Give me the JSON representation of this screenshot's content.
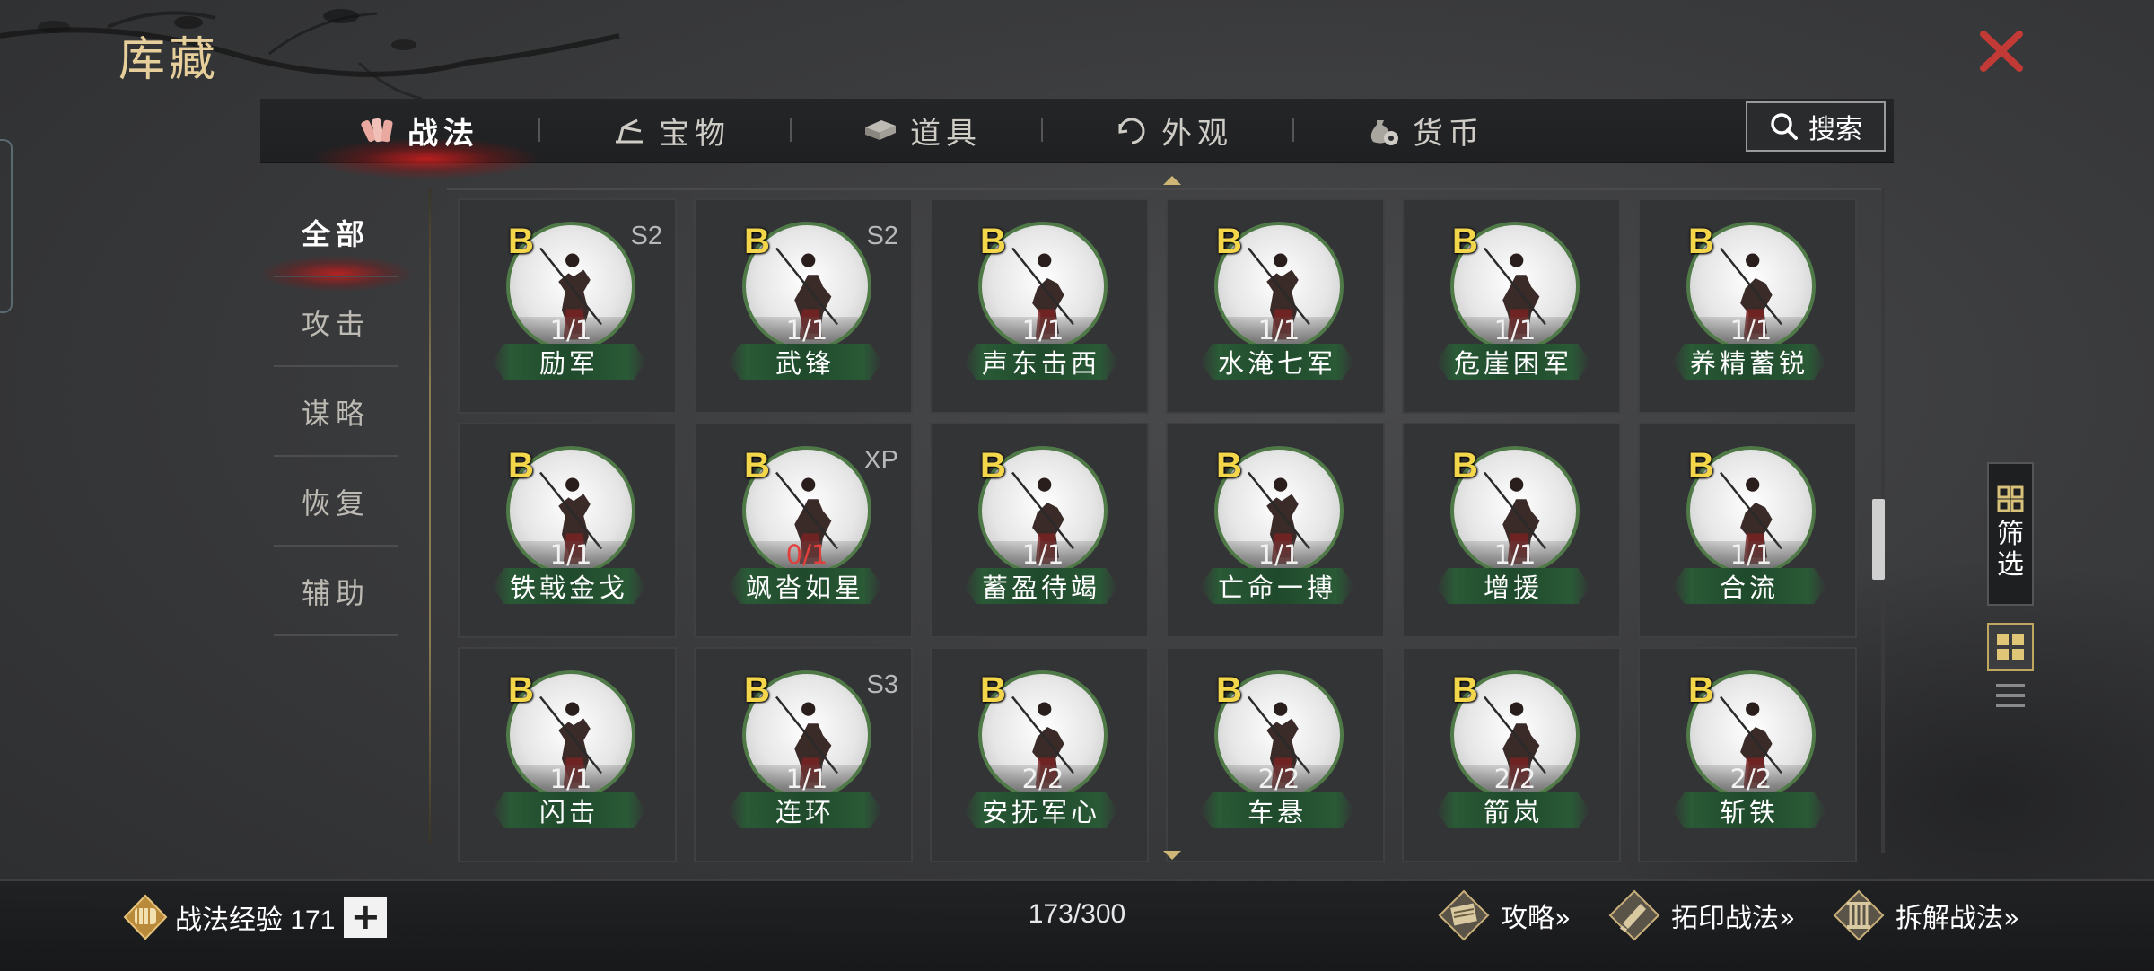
{
  "page_title": "库藏",
  "tabs": [
    {
      "label": "战法",
      "icon": "scroll-bundle-icon",
      "active": true
    },
    {
      "label": "宝物",
      "icon": "treasure-icon",
      "active": false
    },
    {
      "label": "道具",
      "icon": "item-box-icon",
      "active": false
    },
    {
      "label": "外观",
      "icon": "appearance-icon",
      "active": false
    },
    {
      "label": "货币",
      "icon": "money-bag-icon",
      "active": false
    }
  ],
  "search": {
    "label": "搜索"
  },
  "categories": [
    {
      "label": "全部",
      "active": true
    },
    {
      "label": "攻击",
      "active": false
    },
    {
      "label": "谋略",
      "active": false
    },
    {
      "label": "恢复",
      "active": false
    },
    {
      "label": "辅助",
      "active": false
    }
  ],
  "tactics": [
    {
      "name": "励军",
      "grade": "B",
      "count": "1/1",
      "season": "S2",
      "count_alert": false
    },
    {
      "name": "武锋",
      "grade": "B",
      "count": "1/1",
      "season": "S2",
      "count_alert": false
    },
    {
      "name": "声东击西",
      "grade": "B",
      "count": "1/1",
      "season": "",
      "count_alert": false
    },
    {
      "name": "水淹七军",
      "grade": "B",
      "count": "1/1",
      "season": "",
      "count_alert": false
    },
    {
      "name": "危崖困军",
      "grade": "B",
      "count": "1/1",
      "season": "",
      "count_alert": false
    },
    {
      "name": "养精蓄锐",
      "grade": "B",
      "count": "1/1",
      "season": "",
      "count_alert": false
    },
    {
      "name": "铁戟金戈",
      "grade": "B",
      "count": "1/1",
      "season": "",
      "count_alert": false
    },
    {
      "name": "飒沓如星",
      "grade": "B",
      "count": "0/1",
      "season": "XP",
      "count_alert": true
    },
    {
      "name": "蓄盈待竭",
      "grade": "B",
      "count": "1/1",
      "season": "",
      "count_alert": false
    },
    {
      "name": "亡命一搏",
      "grade": "B",
      "count": "1/1",
      "season": "",
      "count_alert": false
    },
    {
      "name": "增援",
      "grade": "B",
      "count": "1/1",
      "season": "",
      "count_alert": false
    },
    {
      "name": "合流",
      "grade": "B",
      "count": "1/1",
      "season": "",
      "count_alert": false
    },
    {
      "name": "闪击",
      "grade": "B",
      "count": "1/1",
      "season": "",
      "count_alert": false
    },
    {
      "name": "连环",
      "grade": "B",
      "count": "1/1",
      "season": "S3",
      "count_alert": false
    },
    {
      "name": "安抚军心",
      "grade": "B",
      "count": "2/2",
      "season": "",
      "count_alert": false
    },
    {
      "name": "车悬",
      "grade": "B",
      "count": "2/2",
      "season": "",
      "count_alert": false
    },
    {
      "name": "箭岚",
      "grade": "B",
      "count": "2/2",
      "season": "",
      "count_alert": false
    },
    {
      "name": "斩铁",
      "grade": "B",
      "count": "2/2",
      "season": "",
      "count_alert": false
    }
  ],
  "filter": {
    "label": "筛选"
  },
  "footer": {
    "exp_label": "战法经验 171",
    "plus": "+",
    "capacity": "173/300",
    "actions": [
      {
        "label": "攻略»",
        "icon": "strategy-book-icon"
      },
      {
        "label": "拓印战法»",
        "icon": "rubbing-icon"
      },
      {
        "label": "拆解战法»",
        "icon": "dismantle-icon"
      }
    ]
  },
  "colors": {
    "accent_gold": "#e6cf9a",
    "grade_gold": "#f4d64a",
    "ribbon_green": "#2a5a36",
    "alert_red": "#e2403c",
    "close_red": "#c23a36"
  }
}
